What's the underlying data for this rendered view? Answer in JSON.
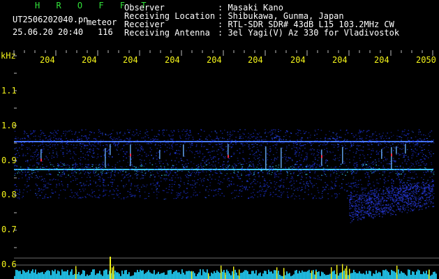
{
  "header": {
    "program": "H R O F F T",
    "filename": "UT2506202040.pn",
    "mode": "meteor",
    "datetime": "25.06.20 20:40",
    "count": "116",
    "rows": [
      {
        "label": "Observer",
        "value": ": Masaki Kano"
      },
      {
        "label": "Receiving Location",
        "value": ": Shibukawa, Gunma, Japan"
      },
      {
        "label": "Receiver",
        "value": ": RTL-SDR SDR# 43dB L15 103.2MHz CW"
      },
      {
        "label": "Receiving Antenna",
        "value": ": 3el Yagi(V) Az 330 for Vladivostok"
      }
    ]
  },
  "axis": {
    "unit": "kHz",
    "y_labels": [
      "1.1",
      "1.0",
      "0.9",
      "0.8",
      "0.7",
      "0.6"
    ],
    "x_labels": [
      "204",
      "204",
      "204",
      "204",
      "204",
      "204",
      "204",
      "204",
      "204",
      "2050"
    ]
  },
  "colors": {
    "header_green": "#32e23a",
    "axis_yellow": "#f5f51a",
    "noise_blue": "#1c2fd4",
    "signal_cyan": "#3ad8ff",
    "echo_red": "#ff2a4a",
    "bar_cyan": "#22c8f0"
  }
}
